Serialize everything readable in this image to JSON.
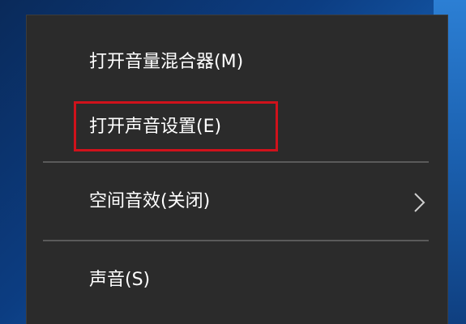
{
  "context_menu": {
    "items": [
      {
        "label": "打开音量混合器(M)"
      },
      {
        "label": "打开声音设置(E)"
      },
      {
        "label": "空间音效(关闭)",
        "has_submenu": true,
        "submenu_icon": "chevron-right-icon"
      },
      {
        "label": "声音(S)"
      }
    ],
    "highlighted_item": "打开声音设置(E)"
  },
  "colors": {
    "menu_background": "#2b2b2b",
    "text": "#ffffff",
    "separator": "#5a5a5a",
    "highlight_border": "#d0121b",
    "desktop_blue": "#1763b8"
  }
}
